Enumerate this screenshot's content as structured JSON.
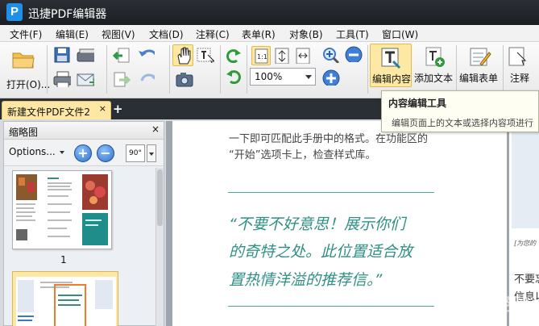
{
  "app": {
    "title": "迅捷PDF编辑器",
    "logo_letter": "P"
  },
  "menu": [
    "文件(F)",
    "编辑(E)",
    "视图(V)",
    "文档(D)",
    "注释(C)",
    "表单(R)",
    "对象(B)",
    "工具(T)",
    "窗口(W)"
  ],
  "toolbar": {
    "open_label": "打开(O)...",
    "zoom_value": "100%",
    "edit_content_label": "编辑内容",
    "add_text_label": "添加文本",
    "edit_form_label": "编辑表单",
    "annotate_label": "注释"
  },
  "tabs": {
    "doc_tab": "新建文件PDF文件2",
    "close": "×",
    "add": "+"
  },
  "tooltip": {
    "title": "内容编辑工具",
    "desc": "编辑页面上的文本或选择内容项进行"
  },
  "sidebar": {
    "title": "缩略图",
    "close": "×",
    "options_label": "Options...",
    "zoom_in": "+",
    "zoom_out": "−",
    "rotate": "90°",
    "page_number": "1"
  },
  "document": {
    "para_line1": "一下即可匹配此手册中的格式。在功能区的",
    "para_line2": "“开始”选项卡上，检查样式库。",
    "quote_line1": "“不要不好意思！展示你们",
    "quote_line2": "的奇特之处。此位置适合放",
    "quote_line3": "置热情洋溢的推荐信。”",
    "right_caption": "[为您的",
    "right_text1": "不要忘",
    "right_text2": "信息以"
  },
  "watermark": "Baidu经验",
  "colors": {
    "accent_teal": "#2f8f85",
    "tab_active": "#fde7a3",
    "titlebar": "#1b1e23"
  }
}
